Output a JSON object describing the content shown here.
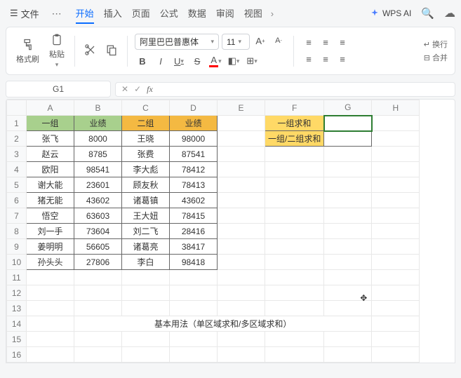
{
  "titlebar": {
    "file_label": "文件",
    "tabs": [
      "开始",
      "插入",
      "页面",
      "公式",
      "数据",
      "审阅",
      "视图"
    ],
    "active_tab_index": 0,
    "ai_label": "WPS AI"
  },
  "ribbon": {
    "format_painter_label": "格式刷",
    "paste_label": "粘贴",
    "font_name": "阿里巴巴普惠体",
    "font_size": "11",
    "btn_bold": "B",
    "btn_italic": "I",
    "btn_underline": "U",
    "btn_strike": "S",
    "btn_font_a": "A",
    "wrap_label": "换行",
    "merge_label": "合并"
  },
  "namebox": {
    "cell_ref": "G1",
    "fx_label": "fx"
  },
  "sheet": {
    "cols": [
      "A",
      "B",
      "C",
      "D",
      "E",
      "F",
      "G",
      "H"
    ],
    "rows": [
      "1",
      "2",
      "3",
      "4",
      "5",
      "6",
      "7",
      "8",
      "9",
      "10",
      "11",
      "12",
      "13",
      "14",
      "15",
      "16"
    ],
    "headers": {
      "A": "一组",
      "B": "业绩",
      "C": "二组",
      "D": "业绩"
    },
    "labels": {
      "F1": "一组求和",
      "F2": "一组/二组求和"
    },
    "data": [
      {
        "A": "张飞",
        "B": "8000",
        "C": "王晓",
        "D": "98000"
      },
      {
        "A": "赵云",
        "B": "8785",
        "C": "张费",
        "D": "87541"
      },
      {
        "A": "欧阳",
        "B": "98541",
        "C": "李大彪",
        "D": "78412"
      },
      {
        "A": "谢大能",
        "B": "23601",
        "C": "顾友秋",
        "D": "78413"
      },
      {
        "A": "猪无能",
        "B": "43602",
        "C": "诸葛镇",
        "D": "43602"
      },
      {
        "A": "悟空",
        "B": "63603",
        "C": "王大妞",
        "D": "78415"
      },
      {
        "A": "刘一手",
        "B": "73604",
        "C": "刘二飞",
        "D": "28416"
      },
      {
        "A": "姜明明",
        "B": "56605",
        "C": "诸葛亮",
        "D": "38417"
      },
      {
        "A": "孙头头",
        "B": "27806",
        "C": "李白",
        "D": "98418"
      }
    ],
    "note": "基本用法（单区域求和/多区域求和）"
  },
  "chart_data": {
    "type": "table",
    "title": "业绩",
    "series": [
      {
        "name": "一组",
        "categories": [
          "张飞",
          "赵云",
          "欧阳",
          "谢大能",
          "猪无能",
          "悟空",
          "刘一手",
          "姜明明",
          "孙头头"
        ],
        "values": [
          8000,
          8785,
          98541,
          23601,
          43602,
          63603,
          73604,
          56605,
          27806
        ]
      },
      {
        "name": "二组",
        "categories": [
          "王晓",
          "张费",
          "李大彪",
          "顾友秋",
          "诸葛镇",
          "王大妞",
          "刘二飞",
          "诸葛亮",
          "李白"
        ],
        "values": [
          98000,
          87541,
          78412,
          78413,
          43602,
          78415,
          28416,
          38417,
          98418
        ]
      }
    ]
  }
}
